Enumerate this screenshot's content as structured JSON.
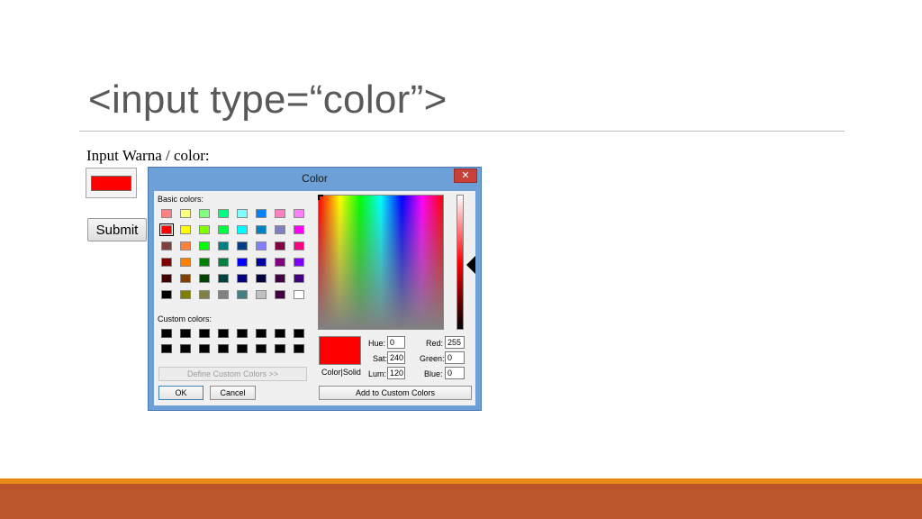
{
  "slide": {
    "title": "<input type=“color”>"
  },
  "form": {
    "label": "Input Warna / color:",
    "color_value": "#ff0000",
    "submit_label": "Submit"
  },
  "dialog": {
    "title": "Color",
    "close_glyph": "✕",
    "basic_colors_label": "Basic colors:",
    "custom_colors_label": "Custom colors:",
    "define_custom_label": "Define Custom Colors >>",
    "ok_label": "OK",
    "cancel_label": "Cancel",
    "add_custom_label": "Add to Custom Colors",
    "color_solid_label": "Color|Solid",
    "fields": {
      "hue": {
        "label": "Hue:",
        "value": "0"
      },
      "sat": {
        "label": "Sat:",
        "value": "240"
      },
      "lum": {
        "label": "Lum:",
        "value": "120"
      },
      "red": {
        "label": "Red:",
        "value": "255"
      },
      "green": {
        "label": "Green:",
        "value": "0"
      },
      "blue": {
        "label": "Blue:",
        "value": "0"
      }
    },
    "basic_colors": [
      [
        "#ff8080",
        "#ffff80",
        "#80ff80",
        "#00ff80",
        "#80ffff",
        "#0080ff",
        "#ff80c0",
        "#ff80ff"
      ],
      [
        "#ff0000",
        "#ffff00",
        "#80ff00",
        "#00ff40",
        "#00ffff",
        "#0080c0",
        "#8080c0",
        "#ff00ff"
      ],
      [
        "#804040",
        "#ff8040",
        "#00ff00",
        "#008080",
        "#004080",
        "#8080ff",
        "#800040",
        "#ff0080"
      ],
      [
        "#800000",
        "#ff8000",
        "#008000",
        "#008040",
        "#0000ff",
        "#0000a0",
        "#800080",
        "#8000ff"
      ],
      [
        "#400000",
        "#804000",
        "#004000",
        "#004040",
        "#000080",
        "#000040",
        "#400040",
        "#400080"
      ],
      [
        "#000000",
        "#808000",
        "#808040",
        "#808080",
        "#408080",
        "#c0c0c0",
        "#400040",
        "#ffffff"
      ]
    ],
    "selected_basic": [
      1,
      0
    ],
    "custom_color_rows": 2,
    "custom_color_cols": 8
  },
  "theme": {
    "accent_bar_top": "#e8891a",
    "accent_bar_bottom": "#bb562a",
    "dialog_frame": "#6ea0d8"
  }
}
